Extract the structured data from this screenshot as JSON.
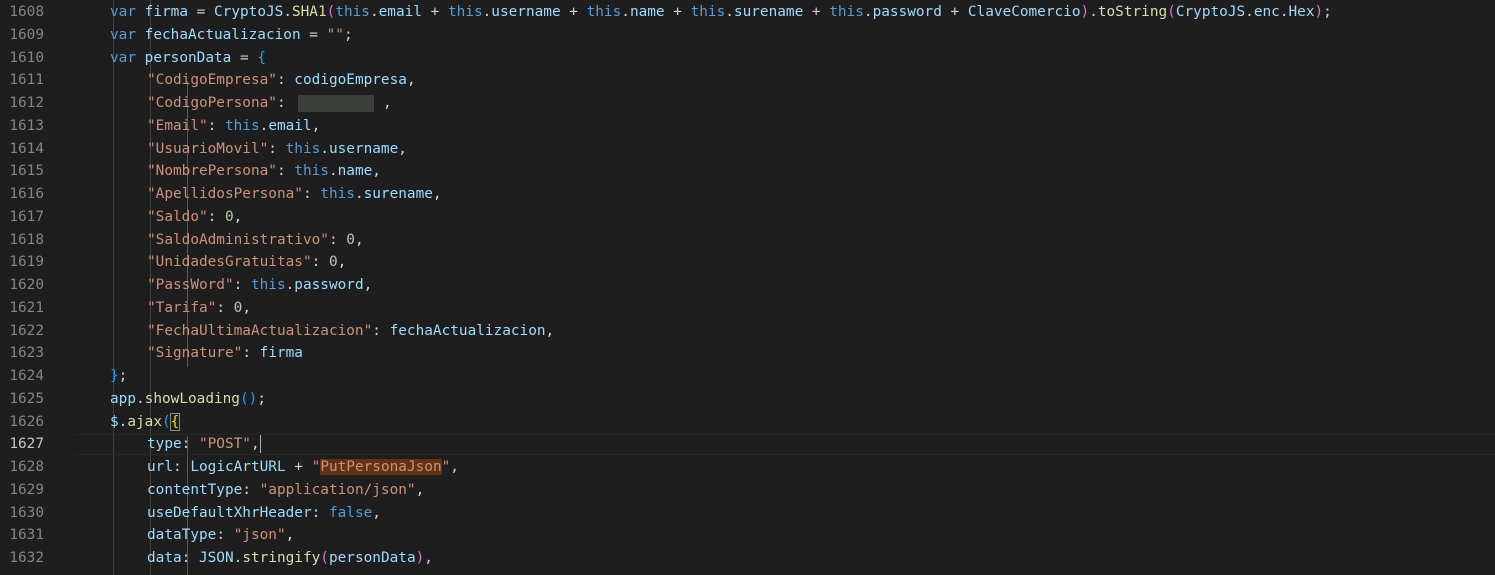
{
  "editor": {
    "active_line": "1627",
    "lines": [
      {
        "num": "1608",
        "tokens": [
          {
            "t": "var",
            "c": "kw"
          },
          {
            "t": " ",
            "c": "plain"
          },
          {
            "t": "firma",
            "c": "var"
          },
          {
            "t": " = ",
            "c": "plain"
          },
          {
            "t": "CryptoJS",
            "c": "var"
          },
          {
            "t": ".",
            "c": "plain"
          },
          {
            "t": "SHA1",
            "c": "fn"
          },
          {
            "t": "(",
            "c": "br2"
          },
          {
            "t": "this",
            "c": "kw"
          },
          {
            "t": ".",
            "c": "plain"
          },
          {
            "t": "email",
            "c": "var"
          },
          {
            "t": " + ",
            "c": "plain"
          },
          {
            "t": "this",
            "c": "kw"
          },
          {
            "t": ".",
            "c": "plain"
          },
          {
            "t": "username",
            "c": "var"
          },
          {
            "t": " + ",
            "c": "plain"
          },
          {
            "t": "this",
            "c": "kw"
          },
          {
            "t": ".",
            "c": "plain"
          },
          {
            "t": "name",
            "c": "var"
          },
          {
            "t": " + ",
            "c": "plain"
          },
          {
            "t": "this",
            "c": "kw"
          },
          {
            "t": ".",
            "c": "plain"
          },
          {
            "t": "surename",
            "c": "var"
          },
          {
            "t": " + ",
            "c": "plain"
          },
          {
            "t": "this",
            "c": "kw"
          },
          {
            "t": ".",
            "c": "plain"
          },
          {
            "t": "password",
            "c": "var"
          },
          {
            "t": " + ",
            "c": "plain"
          },
          {
            "t": "ClaveComercio",
            "c": "var"
          },
          {
            "t": ")",
            "c": "br2"
          },
          {
            "t": ".",
            "c": "plain"
          },
          {
            "t": "toString",
            "c": "fn"
          },
          {
            "t": "(",
            "c": "br2"
          },
          {
            "t": "CryptoJS",
            "c": "var"
          },
          {
            "t": ".",
            "c": "plain"
          },
          {
            "t": "enc",
            "c": "var"
          },
          {
            "t": ".",
            "c": "plain"
          },
          {
            "t": "Hex",
            "c": "var"
          },
          {
            "t": ")",
            "c": "br2"
          },
          {
            "t": ";",
            "c": "plain"
          }
        ]
      },
      {
        "num": "1609",
        "tokens": [
          {
            "t": "var",
            "c": "kw"
          },
          {
            "t": " ",
            "c": "plain"
          },
          {
            "t": "fechaActualizacion",
            "c": "var"
          },
          {
            "t": " = ",
            "c": "plain"
          },
          {
            "t": "\"\"",
            "c": "str"
          },
          {
            "t": ";",
            "c": "plain"
          }
        ]
      },
      {
        "num": "1610",
        "tokens": [
          {
            "t": "var",
            "c": "kw"
          },
          {
            "t": " ",
            "c": "plain"
          },
          {
            "t": "personData",
            "c": "var"
          },
          {
            "t": " = ",
            "c": "plain"
          },
          {
            "t": "{",
            "c": "br3"
          }
        ]
      },
      {
        "num": "1611",
        "indent": 1,
        "tokens": [
          {
            "t": "\"CodigoEmpresa\"",
            "c": "str"
          },
          {
            "t": ": ",
            "c": "plain"
          },
          {
            "t": "codigoEmpresa",
            "c": "var"
          },
          {
            "t": ",",
            "c": "plain"
          }
        ]
      },
      {
        "num": "1612",
        "indent": 1,
        "redacted": true,
        "tokens": [
          {
            "t": "\"CodigoPersona\"",
            "c": "str"
          },
          {
            "t": ": ",
            "c": "plain"
          }
        ],
        "after_redact": [
          {
            "t": " ,",
            "c": "plain"
          }
        ]
      },
      {
        "num": "1613",
        "indent": 1,
        "tokens": [
          {
            "t": "\"Email\"",
            "c": "str"
          },
          {
            "t": ": ",
            "c": "plain"
          },
          {
            "t": "this",
            "c": "kw"
          },
          {
            "t": ".",
            "c": "plain"
          },
          {
            "t": "email",
            "c": "var"
          },
          {
            "t": ",",
            "c": "plain"
          }
        ]
      },
      {
        "num": "1614",
        "indent": 1,
        "tokens": [
          {
            "t": "\"UsuarioMovil\"",
            "c": "str"
          },
          {
            "t": ": ",
            "c": "plain"
          },
          {
            "t": "this",
            "c": "kw"
          },
          {
            "t": ".",
            "c": "plain"
          },
          {
            "t": "username",
            "c": "var"
          },
          {
            "t": ",",
            "c": "plain"
          }
        ]
      },
      {
        "num": "1615",
        "indent": 1,
        "tokens": [
          {
            "t": "\"NombrePersona\"",
            "c": "str"
          },
          {
            "t": ": ",
            "c": "plain"
          },
          {
            "t": "this",
            "c": "kw"
          },
          {
            "t": ".",
            "c": "plain"
          },
          {
            "t": "name",
            "c": "var"
          },
          {
            "t": ",",
            "c": "plain"
          }
        ]
      },
      {
        "num": "1616",
        "indent": 1,
        "tokens": [
          {
            "t": "\"ApellidosPersona\"",
            "c": "str"
          },
          {
            "t": ": ",
            "c": "plain"
          },
          {
            "t": "this",
            "c": "kw"
          },
          {
            "t": ".",
            "c": "plain"
          },
          {
            "t": "surename",
            "c": "var"
          },
          {
            "t": ",",
            "c": "plain"
          }
        ]
      },
      {
        "num": "1617",
        "indent": 1,
        "tokens": [
          {
            "t": "\"Saldo\"",
            "c": "str"
          },
          {
            "t": ": ",
            "c": "plain"
          },
          {
            "t": "0",
            "c": "num"
          },
          {
            "t": ",",
            "c": "plain"
          }
        ]
      },
      {
        "num": "1618",
        "indent": 1,
        "tokens": [
          {
            "t": "\"SaldoAdministrativo\"",
            "c": "str"
          },
          {
            "t": ": ",
            "c": "plain"
          },
          {
            "t": "0",
            "c": "num"
          },
          {
            "t": ",",
            "c": "plain"
          }
        ]
      },
      {
        "num": "1619",
        "indent": 1,
        "tokens": [
          {
            "t": "\"UnidadesGratuitas\"",
            "c": "str"
          },
          {
            "t": ": ",
            "c": "plain"
          },
          {
            "t": "0",
            "c": "num"
          },
          {
            "t": ",",
            "c": "plain"
          }
        ]
      },
      {
        "num": "1620",
        "indent": 1,
        "tokens": [
          {
            "t": "\"PassWord\"",
            "c": "str"
          },
          {
            "t": ": ",
            "c": "plain"
          },
          {
            "t": "this",
            "c": "kw"
          },
          {
            "t": ".",
            "c": "plain"
          },
          {
            "t": "password",
            "c": "var"
          },
          {
            "t": ",",
            "c": "plain"
          }
        ]
      },
      {
        "num": "1621",
        "indent": 1,
        "tokens": [
          {
            "t": "\"Tarifa\"",
            "c": "str"
          },
          {
            "t": ": ",
            "c": "plain"
          },
          {
            "t": "0",
            "c": "num"
          },
          {
            "t": ",",
            "c": "plain"
          }
        ]
      },
      {
        "num": "1622",
        "indent": 1,
        "tokens": [
          {
            "t": "\"FechaUltimaActualizacion\"",
            "c": "str"
          },
          {
            "t": ": ",
            "c": "plain"
          },
          {
            "t": "fechaActualizacion",
            "c": "var"
          },
          {
            "t": ",",
            "c": "plain"
          }
        ]
      },
      {
        "num": "1623",
        "indent": 1,
        "tokens": [
          {
            "t": "\"Signature\"",
            "c": "str"
          },
          {
            "t": ": ",
            "c": "plain"
          },
          {
            "t": "firma",
            "c": "var"
          }
        ]
      },
      {
        "num": "1624",
        "tokens": [
          {
            "t": "}",
            "c": "br3"
          },
          {
            "t": ";",
            "c": "plain"
          }
        ]
      },
      {
        "num": "1625",
        "tokens": [
          {
            "t": "app",
            "c": "var"
          },
          {
            "t": ".",
            "c": "plain"
          },
          {
            "t": "showLoading",
            "c": "fn"
          },
          {
            "t": "()",
            "c": "br3"
          },
          {
            "t": ";",
            "c": "plain"
          }
        ]
      },
      {
        "num": "1626",
        "tokens": [
          {
            "t": "$",
            "c": "var"
          },
          {
            "t": ".",
            "c": "plain"
          },
          {
            "t": "ajax",
            "c": "fn"
          },
          {
            "t": "(",
            "c": "br3"
          },
          {
            "t": "{",
            "c": "br1",
            "box": true
          }
        ]
      },
      {
        "num": "1627",
        "indent": 1,
        "cursor": true,
        "tokens": [
          {
            "t": "type",
            "c": "var"
          },
          {
            "t": ": ",
            "c": "plain"
          },
          {
            "t": "\"POST\"",
            "c": "str"
          },
          {
            "t": ",",
            "c": "plain"
          }
        ]
      },
      {
        "num": "1628",
        "indent": 1,
        "tokens": [
          {
            "t": "url",
            "c": "var"
          },
          {
            "t": ": ",
            "c": "plain"
          },
          {
            "t": "LogicArtURL",
            "c": "var"
          },
          {
            "t": " + ",
            "c": "plain"
          },
          {
            "t": "\"",
            "c": "str"
          },
          {
            "t": "PutPersonaJson",
            "c": "str",
            "hl": true
          },
          {
            "t": "\"",
            "c": "str"
          },
          {
            "t": ",",
            "c": "plain"
          }
        ]
      },
      {
        "num": "1629",
        "indent": 1,
        "tokens": [
          {
            "t": "contentType",
            "c": "var"
          },
          {
            "t": ": ",
            "c": "plain"
          },
          {
            "t": "\"application/json\"",
            "c": "str"
          },
          {
            "t": ",",
            "c": "plain"
          }
        ]
      },
      {
        "num": "1630",
        "indent": 1,
        "tokens": [
          {
            "t": "useDefaultXhrHeader",
            "c": "var"
          },
          {
            "t": ": ",
            "c": "plain"
          },
          {
            "t": "false",
            "c": "bool"
          },
          {
            "t": ",",
            "c": "plain"
          }
        ]
      },
      {
        "num": "1631",
        "indent": 1,
        "tokens": [
          {
            "t": "dataType",
            "c": "var"
          },
          {
            "t": ": ",
            "c": "plain"
          },
          {
            "t": "\"json\"",
            "c": "str"
          },
          {
            "t": ",",
            "c": "plain"
          }
        ]
      },
      {
        "num": "1632",
        "indent": 1,
        "tokens": [
          {
            "t": "data",
            "c": "var"
          },
          {
            "t": ": ",
            "c": "plain"
          },
          {
            "t": "JSON",
            "c": "var"
          },
          {
            "t": ".",
            "c": "plain"
          },
          {
            "t": "stringify",
            "c": "fn"
          },
          {
            "t": "(",
            "c": "br2"
          },
          {
            "t": "personData",
            "c": "var"
          },
          {
            "t": ")",
            "c": "br2"
          },
          {
            "t": ",",
            "c": "plain"
          }
        ]
      }
    ]
  }
}
